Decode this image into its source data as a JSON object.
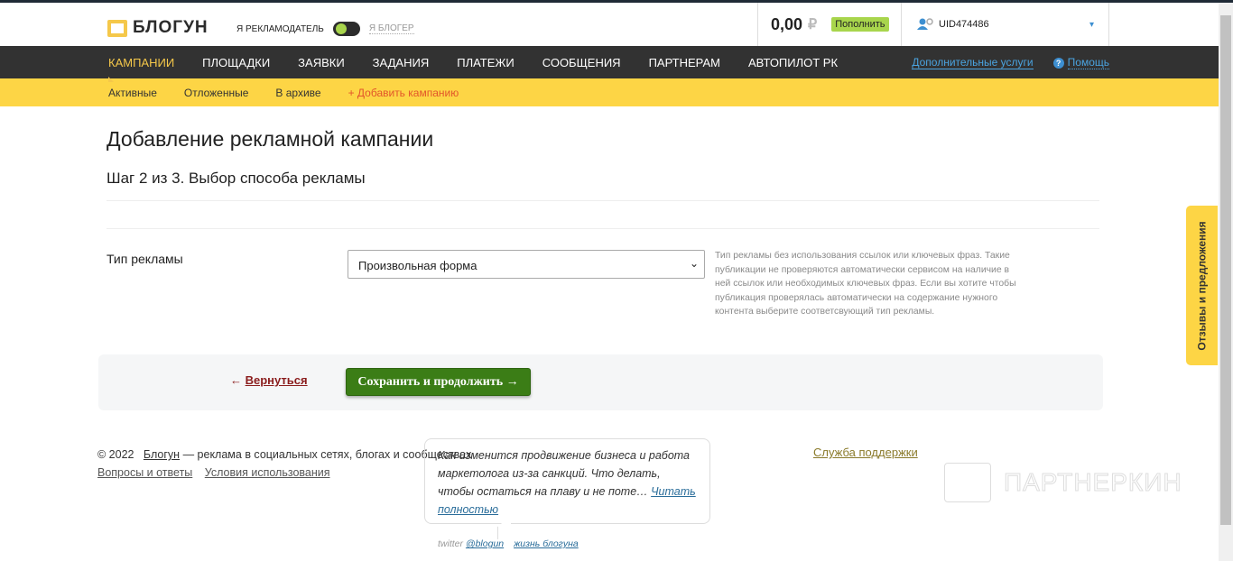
{
  "header": {
    "logo": "БЛОГУН",
    "role_advertiser": "Я РЕКЛАМОДАТЕЛЬ",
    "role_blogger": "Я БЛОГЕР",
    "balance": "0,00",
    "currency": "₽",
    "topup": "Пополнить",
    "user": "UID474486"
  },
  "nav": {
    "items": [
      "КАМПАНИИ",
      "ПЛОЩАДКИ",
      "ЗАЯВКИ",
      "ЗАДАНИЯ",
      "ПЛАТЕЖИ",
      "СООБЩЕНИЯ",
      "ПАРТНЕРАМ",
      "АВТОПИЛОТ РК"
    ],
    "extra": "Дополнительные услуги",
    "help": "Помощь"
  },
  "subnav": {
    "items": [
      "Активные",
      "Отложенные",
      "В архиве"
    ],
    "add": "+ Добавить кампанию"
  },
  "main": {
    "title": "Добавление рекламной кампании",
    "step": "Шаг 2 из 3. Выбор способа рекламы",
    "type_label": "Тип рекламы",
    "type_value": "Произвольная форма",
    "hint": "Тип рекламы без использования ссылок или ключевых фраз. Такие публикации не проверяются автоматически сервисом на наличие в ней ссылок или необходимых ключевых фраз. Если вы хотите чтобы публикация проверялась автоматически на содержание нужного контента выберите соответсвующий тип рекламы.",
    "back": "Вернуться",
    "save": "Сохранить и продолжить →"
  },
  "footer": {
    "copyright": "© 2022",
    "brand": "Блогун",
    "tagline": " — реклама в социальных сетях, блогах и сообществах",
    "faq": "Вопросы и ответы",
    "terms": "Условия использования",
    "news": "Как изменится продвижение бизнеса и работа маркетолога из-за санкций. Что делать, чтобы остаться на плаву и не поте…",
    "read_more": "Читать полностью",
    "twitter": "twitter",
    "twitter_handle": "@blogun",
    "life": "жизнь блогуна",
    "support": "Служба поддержки"
  },
  "watermark": "ПАРТНЕРКИН",
  "feedback": "Отзывы и предложения",
  "colors": {
    "accent": "#fdd545",
    "nav": "#323232",
    "save": "#3b7d16",
    "topup": "#a8d54c"
  }
}
